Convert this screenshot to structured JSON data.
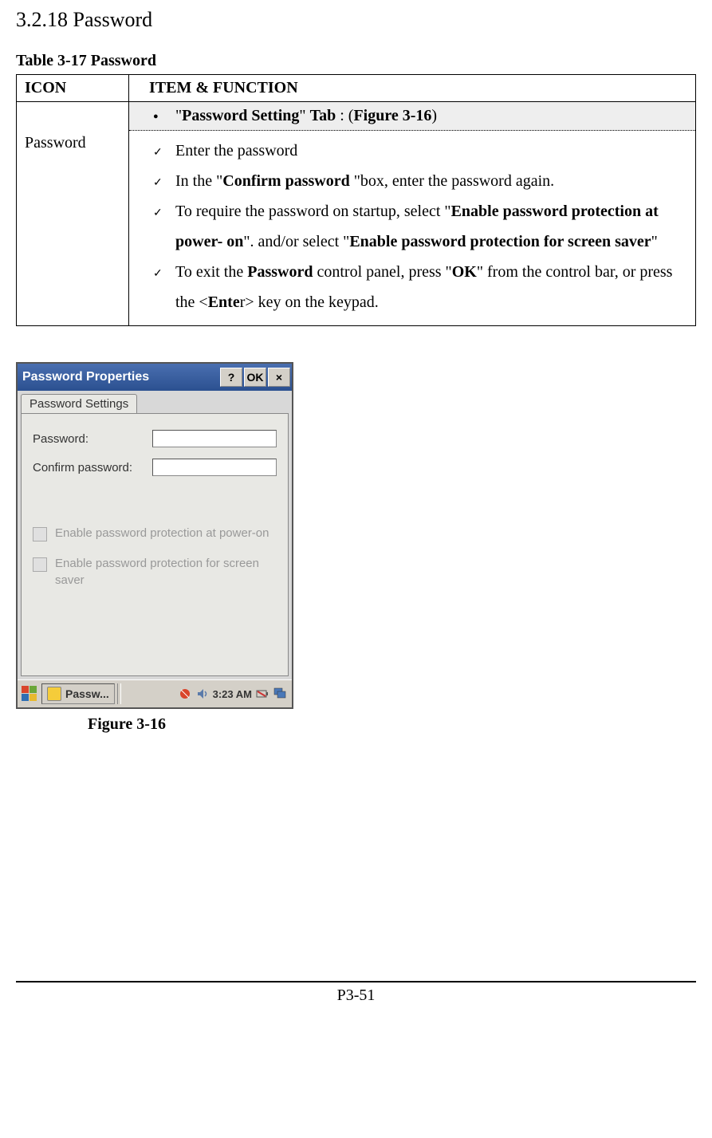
{
  "section": {
    "heading": "3.2.18 Password",
    "table_caption": "Table 3-17    Password",
    "header_icon": "ICON",
    "header_item": "ITEM & FUNCTION",
    "row_icon_label": "Password",
    "tab_title_parts": {
      "q1": "\"",
      "bold1": "Password Setting",
      "q2": "\" ",
      "bold2": "Tab",
      "mid": " : (",
      "bold3": "Figure 3-16",
      "end": ")"
    },
    "items": {
      "i1": "Enter the password",
      "i2": {
        "p1": "In the \"",
        "b1": "Confirm password ",
        "p2": "\"box, enter the password again."
      },
      "i3": {
        "p1": "To require the password on startup, select \"",
        "b1": "Enable password protection at power- on",
        "p2": "\". and/or select \"",
        "b2": "Enable password protection for screen saver",
        "p3": "\""
      },
      "i4": {
        "p1": "To exit the ",
        "b1": "Password",
        "p2": " control panel, press \"",
        "b2": "OK",
        "p3": "\" from the control bar, or press the <",
        "b3": "Ente",
        "p4": "r> key on the keypad."
      }
    }
  },
  "screenshot": {
    "title": "Password Properties",
    "help": "?",
    "ok": "OK",
    "close": "×",
    "tab": "Password Settings",
    "label_password": "Password:",
    "label_confirm": "Confirm password:",
    "check1": "Enable password protection at power-on",
    "check2": "Enable password protection for screen saver",
    "task_label": "Passw...",
    "clock": "3:23 AM"
  },
  "figure_caption": "Figure 3-16",
  "page_number": "P3-51"
}
